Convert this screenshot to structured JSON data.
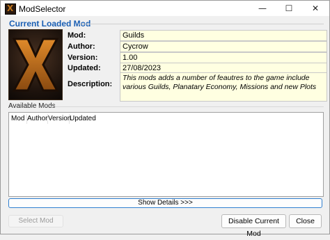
{
  "window": {
    "title": "ModSelector",
    "minimize_glyph": "—",
    "maximize_glyph": "☐",
    "close_glyph": "✕"
  },
  "current_mod": {
    "group_title": "Current Loaded Mod",
    "fields": {
      "mod_label": "Mod:",
      "mod_value": "Guilds",
      "author_label": "Author:",
      "author_value": "Cycrow",
      "version_label": "Version:",
      "version_value": "1.00",
      "updated_label": "Updated:",
      "updated_value": "27/08/2023",
      "description_label": "Description:",
      "description_value": "This mods adds a number of feautres to the game include various Guilds, Planatary Economy, Missions and new Plots"
    },
    "logo_icon": "x-logo-icon"
  },
  "available_mods": {
    "label": "Available Mods",
    "columns": [
      "Mod",
      "Author",
      "Version",
      "Updated"
    ],
    "rows": []
  },
  "buttons": {
    "show_details": "Show Details >>>",
    "select_mod": "Select Mod",
    "disable_current_mod": "Disable Current Mod",
    "close": "Close"
  },
  "colors": {
    "group_title": "#1a5fb4",
    "field_background": "#ffffe1",
    "focus_border": "#2f7fd0",
    "logo_orange": "#c0751c"
  }
}
